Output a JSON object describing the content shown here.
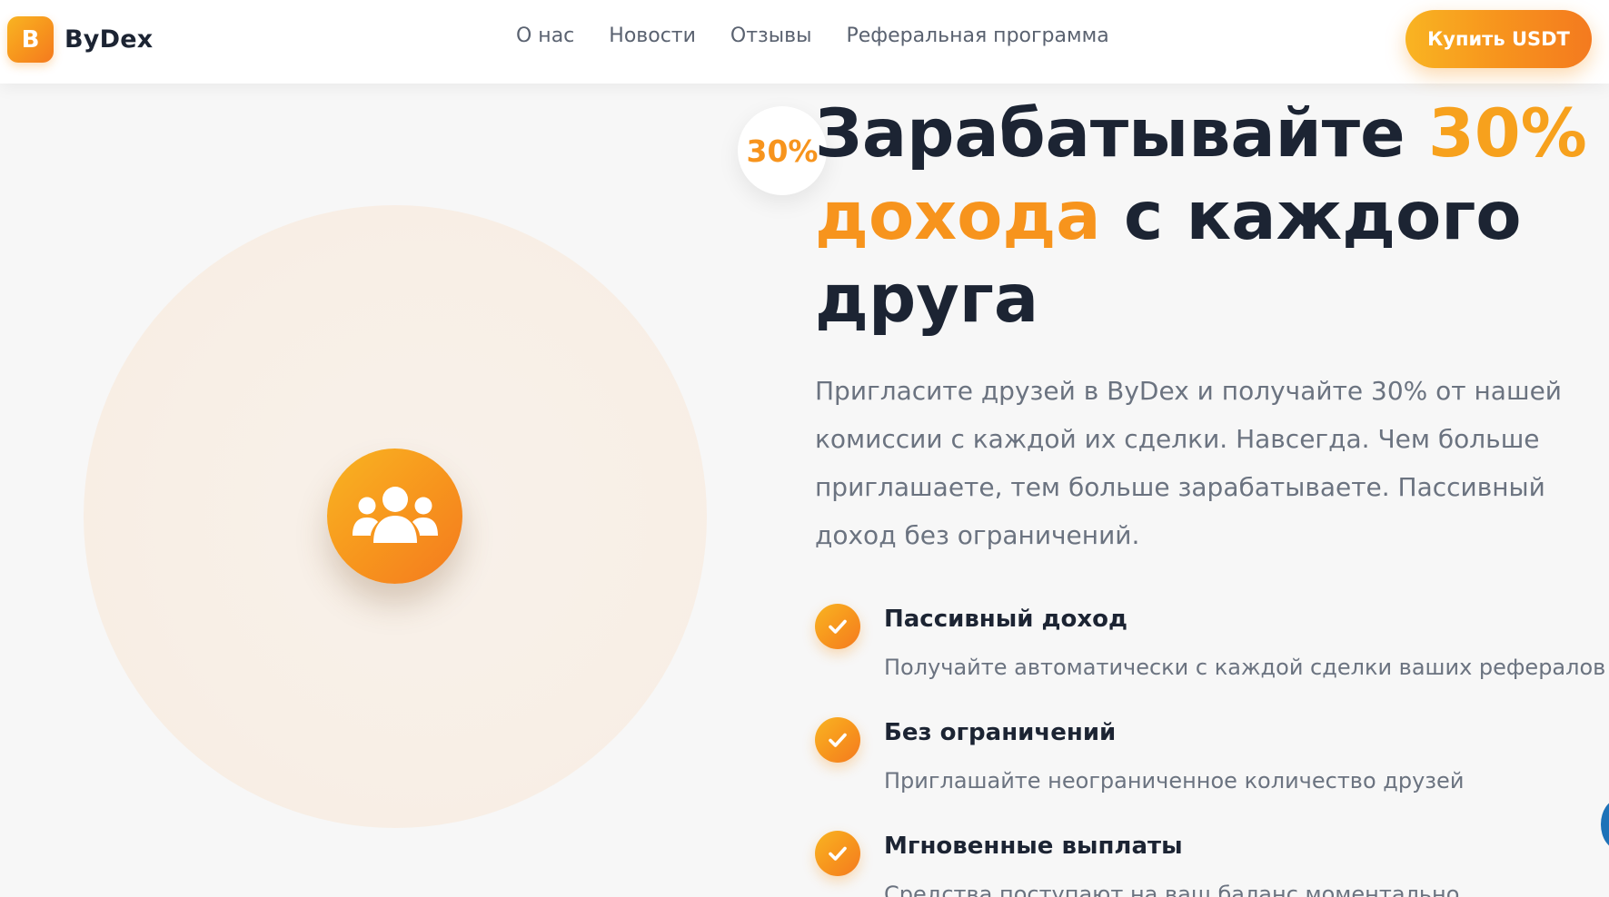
{
  "brand": {
    "logo_letter": "B",
    "name": "ByDex"
  },
  "nav": {
    "items": [
      {
        "label": "О нас"
      },
      {
        "label": "Новости"
      },
      {
        "label": "Отзывы"
      },
      {
        "label": "Реферальная программа"
      }
    ]
  },
  "header": {
    "cta_label": "Купить USDT"
  },
  "hero": {
    "badge": "30%",
    "headline": {
      "part1": "Зарабатывайте ",
      "accent1": "30%",
      "accent2": "дохода",
      "part2": " с каждого друга"
    },
    "lead": "Пригласите друзей в ByDex и получайте 30% от нашей комиссии с каждой их сделки. Навсегда. Чем больше приглашаете, тем больше зарабатываете. Пассивный доход без ограничений."
  },
  "features": [
    {
      "title": "Пассивный доход",
      "description": "Получайте автоматически с каждой сделки ваших рефералов"
    },
    {
      "title": "Без ограничений",
      "description": "Приглашайте неограниченное количество друзей"
    },
    {
      "title": "Мгновенные выплаты",
      "description": "Средства поступают на ваш баланс моментально"
    }
  ],
  "icons": {
    "hero_icon": "users-group-icon",
    "feature_icon": "check-icon"
  },
  "colors": {
    "accent": "#f7941d",
    "accent_light": "#f9b422",
    "text_dark": "#1c2433",
    "text_muted": "#6b7380",
    "background": "#f7f7f7"
  }
}
